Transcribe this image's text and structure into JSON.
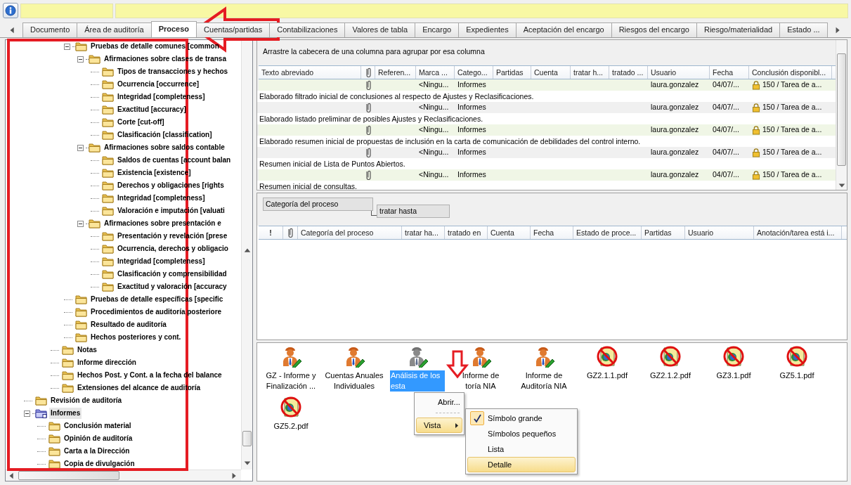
{
  "tabs": [
    {
      "label": "Documento",
      "selected": false
    },
    {
      "label": "Área de auditoría",
      "selected": false
    },
    {
      "label": "Proceso",
      "selected": true
    },
    {
      "label": "Cuentas/partidas",
      "selected": false
    },
    {
      "label": "Contabilizaciones",
      "selected": false
    },
    {
      "label": "Valores de tabla",
      "selected": false
    },
    {
      "label": "Encargo",
      "selected": false
    },
    {
      "label": "Expedientes",
      "selected": false
    },
    {
      "label": "Aceptación del encargo",
      "selected": false
    },
    {
      "label": "Riesgos del encargo",
      "selected": false
    },
    {
      "label": "Riesgo/materialidad",
      "selected": false
    },
    {
      "label": "Estado ...",
      "selected": false
    }
  ],
  "tree": {
    "items": [
      {
        "children": [
          {
            "children": [
              {
                "children": [
                  {
                    "label": "Pruebas de detalle comunes [common",
                    "kind": "folder",
                    "selected": false,
                    "expanded": true,
                    "children": [
                      {
                        "label": "Afirmaciones sobre clases de transa",
                        "kind": "folder",
                        "selected": false,
                        "expanded": true,
                        "children": [
                          {
                            "label": "Tipos de transacciones y hechos",
                            "kind": "folder",
                            "selected": false
                          },
                          {
                            "label": "Ocurrencia [occurrence]",
                            "kind": "folder",
                            "selected": false
                          },
                          {
                            "label": "Integridad [completeness]",
                            "kind": "folder",
                            "selected": false
                          },
                          {
                            "label": "Exactitud [accuracy]",
                            "kind": "folder",
                            "selected": false
                          },
                          {
                            "label": "Corte [cut-off]",
                            "kind": "folder",
                            "selected": false
                          },
                          {
                            "label": "Clasificación [classification]",
                            "kind": "folder",
                            "selected": false
                          }
                        ]
                      },
                      {
                        "label": "Afirmaciones sobre saldos contable",
                        "kind": "folder",
                        "selected": false,
                        "expanded": true,
                        "children": [
                          {
                            "label": "Saldos de cuentas [account balan",
                            "kind": "folder",
                            "selected": false
                          },
                          {
                            "label": "Existencia [existence]",
                            "kind": "folder",
                            "selected": false
                          },
                          {
                            "label": "Derechos y obligaciones [rights",
                            "kind": "folder",
                            "selected": false
                          },
                          {
                            "label": "Integridad [completeness]",
                            "kind": "folder",
                            "selected": false
                          },
                          {
                            "label": "Valoración e imputación [valuati",
                            "kind": "folder",
                            "selected": false
                          }
                        ]
                      },
                      {
                        "label": "Afirmaciones sobre presentación e",
                        "kind": "folder",
                        "selected": false,
                        "expanded": true,
                        "children": [
                          {
                            "label": "Presentación y revelación [prese",
                            "kind": "folder",
                            "selected": false
                          },
                          {
                            "label": "Ocurrencia, derechos y obligacio",
                            "kind": "folder",
                            "selected": false
                          },
                          {
                            "label": "Integridad [completeness]",
                            "kind": "folder",
                            "selected": false
                          },
                          {
                            "label": "Clasificación y comprensibilidad",
                            "kind": "folder",
                            "selected": false
                          },
                          {
                            "label": "Exactitud y valoración [accuracy",
                            "kind": "folder",
                            "selected": false
                          }
                        ]
                      }
                    ]
                  },
                  {
                    "label": "Pruebas de detalle específicas [specific",
                    "kind": "folder",
                    "selected": false
                  },
                  {
                    "label": "Procedimientos de auditoría posteriore",
                    "kind": "folder",
                    "selected": false
                  },
                  {
                    "label": "Resultado de auditoría",
                    "kind": "folder",
                    "selected": false
                  },
                  {
                    "label": "Hechos posteriores y cont.",
                    "kind": "folder",
                    "selected": false
                  }
                ]
              },
              {
                "label": "Notas",
                "kind": "folder",
                "selected": false
              },
              {
                "label": "Informe dirección",
                "kind": "folder",
                "selected": false
              },
              {
                "label": "Hechos Post. y Cont. a la fecha del balance",
                "kind": "folder",
                "selected": false
              },
              {
                "label": "Extensiones del alcance de auditoría",
                "kind": "folder",
                "selected": false
              }
            ]
          }
        ]
      },
      {
        "label": "Revisión de auditoría",
        "kind": "folder",
        "selected": false
      },
      {
        "label": "Informes",
        "kind": "report-folder",
        "selected": true,
        "expanded": true,
        "children": [
          {
            "label": "Conclusión material",
            "kind": "folder",
            "selected": false
          },
          {
            "label": "Opinión de auditoría",
            "kind": "folder",
            "selected": false
          },
          {
            "label": "Carta a la Dirección",
            "kind": "folder",
            "selected": false
          },
          {
            "label": "Copia de divulgación",
            "kind": "folder",
            "selected": false
          }
        ]
      }
    ]
  },
  "top_grid": {
    "group_hint": "Arrastre la cabecera de una columna para agrupar por esa columna",
    "columns": [
      {
        "kind": "text",
        "label": "Texto abreviado"
      },
      {
        "kind": "attachment"
      },
      {
        "kind": "text",
        "label": "Referen..."
      },
      {
        "kind": "text",
        "label": "Marca ..."
      },
      {
        "kind": "text",
        "label": "Catego..."
      },
      {
        "kind": "text",
        "label": "Partidas"
      },
      {
        "kind": "text",
        "label": "Cuenta"
      },
      {
        "kind": "text",
        "label": "tratar h..."
      },
      {
        "kind": "text",
        "label": "tratado ..."
      },
      {
        "kind": "text",
        "label": "Usuario"
      },
      {
        "kind": "text",
        "label": "Fecha"
      },
      {
        "kind": "text",
        "label": "Conclusión disponibl..."
      }
    ],
    "rows": [
      {
        "attachment": true,
        "locked": true,
        "cells": [
          null,
          null,
          null,
          "<Ningu...",
          "Informes",
          null,
          null,
          null,
          null,
          "laura.gonzalez",
          "04/07/...",
          "150 / Tarea de a..."
        ],
        "description": "Elaborado filtrado inicial de conclusiones al respecto de Ajustes y Reclasificaciones."
      },
      {
        "attachment": true,
        "locked": true,
        "cells": [
          null,
          null,
          null,
          "<Ningu...",
          "Informes",
          null,
          null,
          null,
          null,
          "laura.gonzalez",
          "04/07/...",
          "150 / Tarea de a..."
        ],
        "description": "Elaborado listado preliminar de posibles Ajustes y Reclasificaciones."
      },
      {
        "attachment": true,
        "locked": true,
        "cells": [
          null,
          null,
          null,
          "<Ningu...",
          "Informes",
          null,
          null,
          null,
          null,
          "laura.gonzalez",
          "04/07/...",
          "150 / Tarea de a..."
        ],
        "description": "Elaborado resumen inicial de propuestas de inclusión en la carta de comunicación de debilidades del control interno."
      },
      {
        "attachment": true,
        "locked": true,
        "cells": [
          null,
          null,
          null,
          "<Ningu...",
          "Informes",
          null,
          null,
          null,
          null,
          "laura.gonzalez",
          "04/07/...",
          "150 / Tarea de a..."
        ],
        "description": "Resumen inicial de Lista de Puntos Abiertos."
      },
      {
        "attachment": true,
        "locked": true,
        "cells": [
          null,
          null,
          null,
          "<Ningu...",
          "Informes",
          null,
          null,
          null,
          null,
          "laura.gonzalez",
          "04/07/...",
          "150 / Tarea de a..."
        ],
        "description": "Resumen inicial de consultas."
      }
    ]
  },
  "process_grid": {
    "group_boxes": [
      {
        "label": "Categoría del proceso"
      },
      {
        "label": "tratar hasta"
      }
    ],
    "columns": [
      {
        "kind": "text",
        "label": "!"
      },
      {
        "kind": "attachment"
      },
      {
        "kind": "text",
        "label": "Categoría del proceso"
      },
      {
        "kind": "text",
        "label": "tratar ha..."
      },
      {
        "kind": "text",
        "label": "tratado en"
      },
      {
        "kind": "text",
        "label": "Cuenta"
      },
      {
        "kind": "text",
        "label": "Fecha"
      },
      {
        "kind": "text",
        "label": "Estado de proce..."
      },
      {
        "kind": "text",
        "label": "Partidas"
      },
      {
        "kind": "text",
        "label": "Usuario"
      },
      {
        "kind": "text",
        "label": "Anotación/tarea está i..."
      }
    ]
  },
  "icon_view": {
    "items": [
      {
        "label": "GZ - Informe y\nFinalización ...",
        "kind": "person",
        "selected": false,
        "greyed": false
      },
      {
        "label": "Cuentas Anuales\nIndividuales",
        "kind": "person",
        "selected": false,
        "greyed": false
      },
      {
        "label": "Análisis de los\nesta",
        "kind": "person",
        "selected": true,
        "greyed": true
      },
      {
        "label": "Informe de\ntoría NIA",
        "kind": "person",
        "selected": false,
        "greyed": false
      },
      {
        "label": "Informe de\nAuditoría NIA",
        "kind": "person",
        "selected": false,
        "greyed": false
      },
      {
        "label": "GZ2.1.1.pdf",
        "kind": "pdf",
        "selected": false,
        "greyed": false
      },
      {
        "label": "GZ2.1.2.pdf",
        "kind": "pdf",
        "selected": false,
        "greyed": false
      },
      {
        "label": "GZ3.1.pdf",
        "kind": "pdf",
        "selected": false,
        "greyed": false
      },
      {
        "label": "GZ5.1.pdf",
        "kind": "pdf",
        "selected": false,
        "greyed": false
      },
      {
        "label": "GZ5.2.pdf",
        "kind": "pdf",
        "selected": false,
        "greyed": false
      }
    ]
  },
  "context_menu": {
    "items": [
      {
        "kind": "item",
        "label": "Abrir...",
        "highlighted": false
      },
      {
        "kind": "separator"
      },
      {
        "kind": "submenu",
        "label": "Vista",
        "highlighted": true
      }
    ],
    "submenu": [
      {
        "label": "Símbolo grande",
        "checked": true,
        "highlighted": false
      },
      {
        "label": "Símbolos pequeños",
        "checked": false,
        "highlighted": false
      },
      {
        "label": "Lista",
        "checked": false,
        "highlighted": false
      },
      {
        "label": "Detalle",
        "checked": false,
        "highlighted": true
      }
    ]
  },
  "annotations": [
    {
      "kind": "frame"
    },
    {
      "kind": "arrow-left"
    },
    {
      "kind": "arrow-down"
    }
  ]
}
